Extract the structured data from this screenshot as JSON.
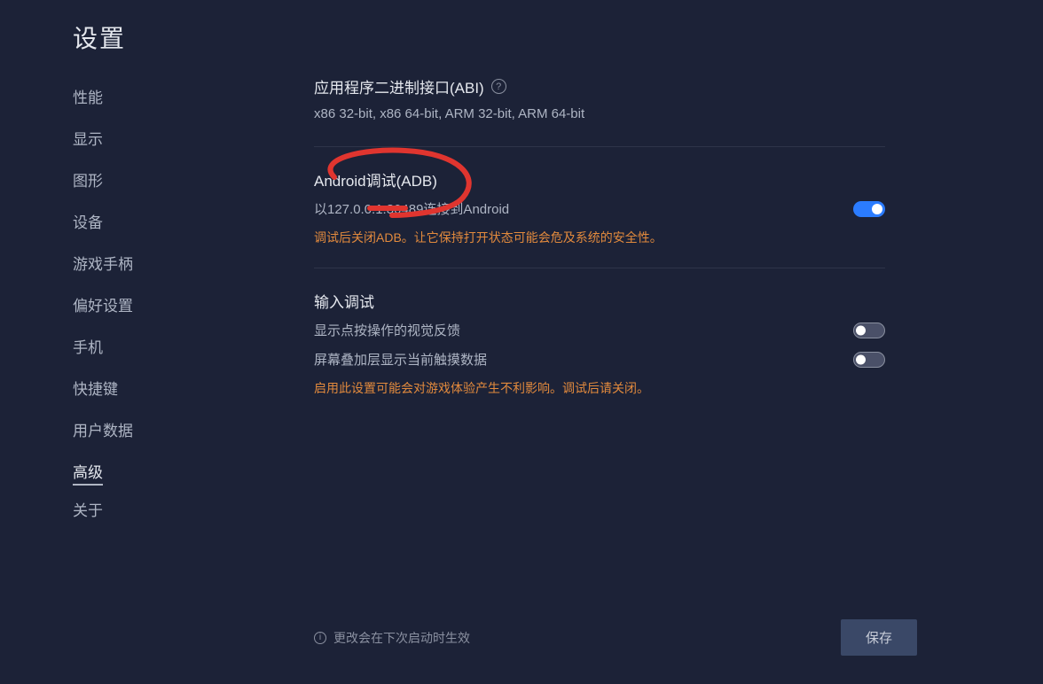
{
  "page_title": "设置",
  "sidebar": {
    "items": [
      {
        "label": "性能",
        "active": false
      },
      {
        "label": "显示",
        "active": false
      },
      {
        "label": "图形",
        "active": false
      },
      {
        "label": "设备",
        "active": false
      },
      {
        "label": "游戏手柄",
        "active": false
      },
      {
        "label": "偏好设置",
        "active": false
      },
      {
        "label": "手机",
        "active": false
      },
      {
        "label": "快捷键",
        "active": false
      },
      {
        "label": "用户数据",
        "active": false
      },
      {
        "label": "高级",
        "active": true
      },
      {
        "label": "关于",
        "active": false
      }
    ]
  },
  "sections": {
    "abi": {
      "title": "应用程序二进制接口(ABI)",
      "value": "x86 32-bit, x86 64-bit, ARM 32-bit, ARM 64-bit"
    },
    "adb": {
      "title": "Android调试(ADB)",
      "connection": "以127.0.0.1:30489连接到Android",
      "toggle_on": true,
      "warning": "调试后关闭ADB。让它保持打开状态可能会危及系统的安全性。"
    },
    "input_debug": {
      "title": "输入调试",
      "rows": [
        {
          "label": "显示点按操作的视觉反馈",
          "on": false
        },
        {
          "label": "屏幕叠加层显示当前触摸数据",
          "on": false
        }
      ],
      "warning": "启用此设置可能会对游戏体验产生不利影响。调试后请关闭。"
    }
  },
  "footer": {
    "note": "更改会在下次启动时生效",
    "save": "保存"
  },
  "annotation_color": "#e0352f"
}
